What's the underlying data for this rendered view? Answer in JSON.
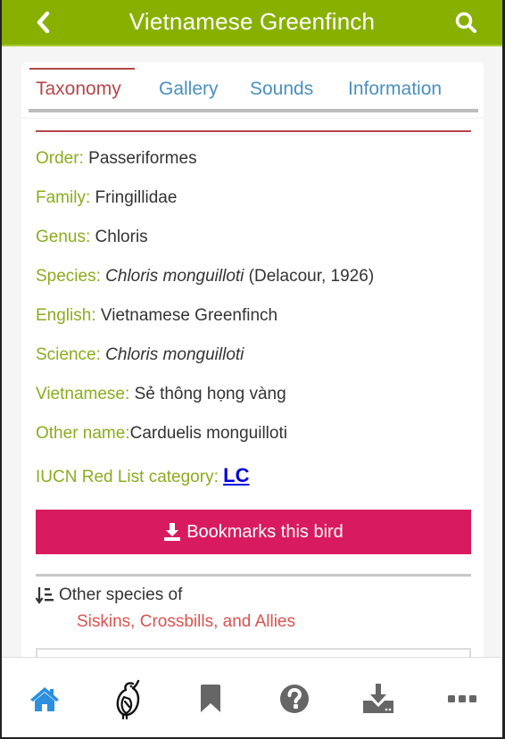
{
  "header": {
    "title": "Vietnamese Greenfinch",
    "back_icon": "chevron-left-icon",
    "search_icon": "search-icon"
  },
  "tabs": [
    {
      "label": "Taxonomy",
      "active": true
    },
    {
      "label": "Gallery",
      "active": false
    },
    {
      "label": "Sounds",
      "active": false
    },
    {
      "label": "Information",
      "active": false
    }
  ],
  "taxonomy": {
    "order": {
      "label": "Order:",
      "value": "Passeriformes"
    },
    "family": {
      "label": "Family:",
      "value": "Fringillidae"
    },
    "genus": {
      "label": "Genus:",
      "value": "Chloris"
    },
    "species": {
      "label": "Species:",
      "value_italic": "Chloris monguilloti",
      "value_suffix": "(Delacour, 1926)"
    },
    "english": {
      "label": "English:",
      "value": "Vietnamese Greenfinch"
    },
    "science": {
      "label": "Science:",
      "value_italic": "Chloris monguilloti"
    },
    "vietnamese": {
      "label": "Vietnamese:",
      "value": "Sẻ thông họng vàng"
    },
    "other_name": {
      "label": "Other name:",
      "value": "Carduelis monguilloti"
    },
    "iucn": {
      "label": "IUCN Red List category:",
      "value": "LC"
    }
  },
  "bookmark_button": {
    "label": "Bookmarks this bird",
    "icon": "download-icon"
  },
  "other_species": {
    "label": "Other species of",
    "icon": "sort-amount-down-icon",
    "family_link": "Siskins, Crossbills, and Allies"
  },
  "bottom_nav": [
    {
      "name": "home",
      "icon": "home-icon",
      "active": true
    },
    {
      "name": "birds",
      "icon": "bird-icon",
      "active": false
    },
    {
      "name": "bookmarks",
      "icon": "bookmark-icon",
      "active": false
    },
    {
      "name": "help",
      "icon": "question-circle-icon",
      "active": false
    },
    {
      "name": "downloads",
      "icon": "download-icon",
      "active": false
    },
    {
      "name": "more",
      "icon": "more-icon",
      "active": false
    }
  ],
  "colors": {
    "header_green": "#88b000",
    "label_green": "#8aad1e",
    "tab_active": "#b5474a",
    "tab_inactive": "#4a90bf",
    "bookmark_pink": "#d81b5f",
    "link_red": "#d9534f",
    "nav_active_blue": "#2c8fe0",
    "nav_gray": "#666666"
  }
}
